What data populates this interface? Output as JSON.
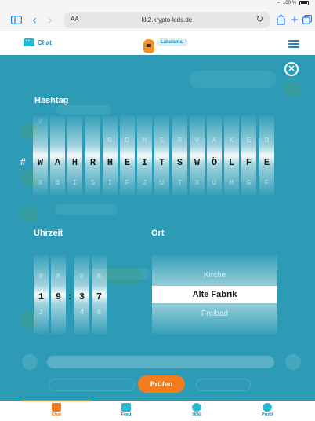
{
  "status_bar": {
    "battery": "100 %"
  },
  "browser": {
    "text_size_label": "AA",
    "url": "kk2.krypto-kids.de",
    "icons": [
      "sidebar-icon",
      "back-icon",
      "forward-icon",
      "reload-icon",
      "share-icon",
      "new-tab-icon",
      "tabs-icon"
    ]
  },
  "header": {
    "chat_label": "Chat",
    "mascot_bubble": "Labalama!"
  },
  "hashtag": {
    "title": "Hashtag",
    "prefix": "#",
    "columns": [
      {
        "up2": "V",
        "up1": "",
        "main": "W",
        "down": "X"
      },
      {
        "up2": "",
        "up1": "",
        "main": "A",
        "down": "B"
      },
      {
        "up2": "",
        "up1": "",
        "main": "H",
        "down": "I"
      },
      {
        "up2": "",
        "up1": "",
        "main": "R",
        "down": "S"
      },
      {
        "up2": "",
        "up1": "G",
        "main": "H",
        "down": "I"
      },
      {
        "up2": "",
        "up1": "D",
        "main": "E",
        "down": "F"
      },
      {
        "up2": "",
        "up1": "H",
        "main": "I",
        "down": "J"
      },
      {
        "up2": "",
        "up1": "S",
        "main": "T",
        "down": "U"
      },
      {
        "up2": "",
        "up1": "R",
        "main": "S",
        "down": "T"
      },
      {
        "up2": "",
        "up1": "V",
        "main": "W",
        "down": "X"
      },
      {
        "up2": "",
        "up1": "Ä",
        "main": "Ö",
        "down": "Ü"
      },
      {
        "up2": "",
        "up1": "K",
        "main": "L",
        "down": "M"
      },
      {
        "up2": "",
        "up1": "E",
        "main": "F",
        "down": "G"
      },
      {
        "up2": "",
        "up1": "D",
        "main": "E",
        "down": "F"
      }
    ]
  },
  "time": {
    "title": "Uhrzeit",
    "separator": ":",
    "columns": [
      {
        "up1": "0",
        "main": "1",
        "down1": "2",
        "down2": ""
      },
      {
        "up1": "8",
        "main": "9",
        "down1": "",
        "down2": ""
      },
      {
        "up1": "2",
        "main": "3",
        "down1": "4",
        "down2": ""
      },
      {
        "up1": "6",
        "main": "7",
        "down1": "8",
        "down2": ""
      }
    ]
  },
  "location": {
    "title": "Ort",
    "options_above": [
      "",
      "Kirche"
    ],
    "selected": "Alte Fabrik",
    "options_below": [
      "Freibad",
      ""
    ]
  },
  "actions": {
    "check_label": "Prüfen"
  },
  "tabs": [
    {
      "label": "Chat",
      "icon": "chat-icon",
      "color": "#f37c1f"
    },
    {
      "label": "Feed",
      "icon": "feed-icon",
      "color": "#29b7d6"
    },
    {
      "label": "Wiki",
      "icon": "wiki-icon",
      "color": "#29b7d6"
    },
    {
      "label": "Profil",
      "icon": "profile-icon",
      "color": "#29b7d6"
    }
  ],
  "colors": {
    "overlay": "#2d9bb5",
    "accent_orange": "#f37c1f",
    "brand_blue": "#1b8ab0"
  }
}
